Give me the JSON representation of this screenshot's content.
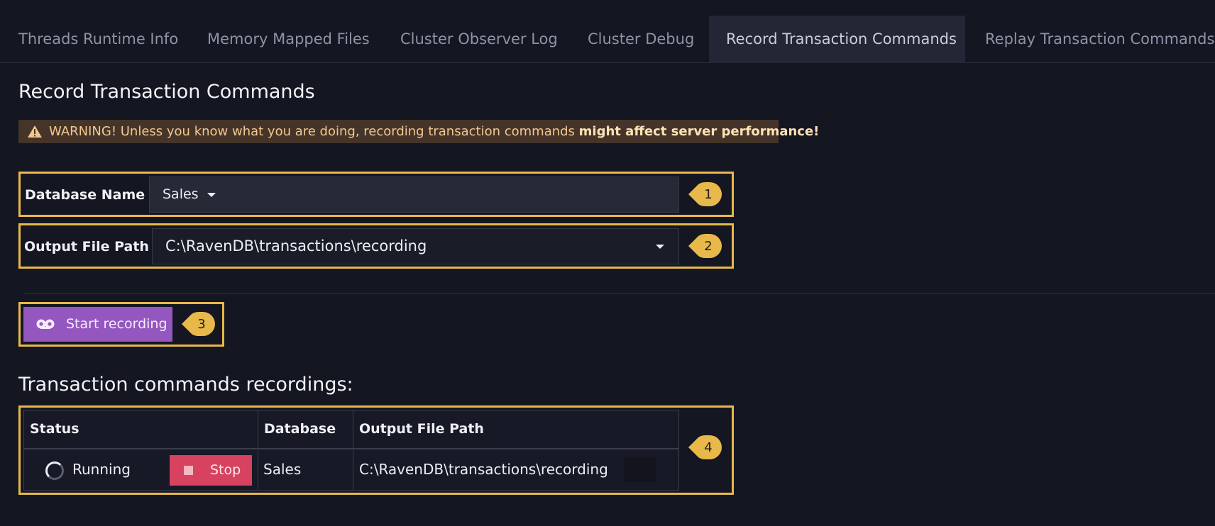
{
  "tabs": [
    {
      "label": "Threads Runtime Info",
      "active": false
    },
    {
      "label": "Memory Mapped Files",
      "active": false
    },
    {
      "label": "Cluster Observer Log",
      "active": false
    },
    {
      "label": "Cluster Debug",
      "active": false
    },
    {
      "label": "Record Transaction Commands",
      "active": true
    },
    {
      "label": "Replay Transaction Commands",
      "active": false
    }
  ],
  "page": {
    "title": "Record Transaction Commands"
  },
  "warning": {
    "icon": "warning-triangle-icon",
    "text": "WARNING! Unless you know what you are doing, recording transaction commands ",
    "emphasis": "might affect server performance!"
  },
  "form": {
    "database_label": "Database Name",
    "database_value": "Sales",
    "path_label": "Output File Path",
    "path_value": "C:\\RavenDB\\transactions\\recording"
  },
  "actions": {
    "start_label": "Start recording",
    "start_icon": "record-icon"
  },
  "recordings": {
    "title": "Transaction commands recordings:",
    "columns": [
      "Status",
      "Database",
      "Output File Path"
    ],
    "rows": [
      {
        "status": "Running",
        "stop_label": "Stop",
        "database": "Sales",
        "path": "C:\\RavenDB\\transactions\\recording"
      }
    ]
  },
  "callouts": [
    "1",
    "2",
    "3",
    "4"
  ],
  "colors": {
    "accent": "#e8b94a",
    "primary_button": "#9457c0",
    "danger_button": "#d6425f",
    "background": "#141622"
  }
}
